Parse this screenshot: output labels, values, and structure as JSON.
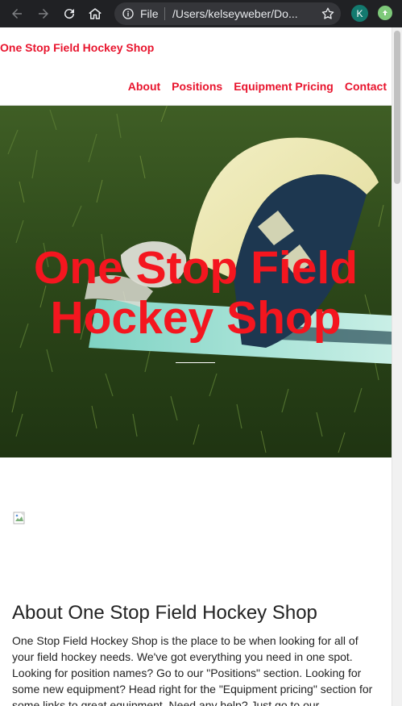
{
  "browser": {
    "scheme_label": "File",
    "url": "/Users/kelseyweber/Do...",
    "profile_initial": "K"
  },
  "site": {
    "brand": "One Stop Field Hockey Shop",
    "nav": [
      {
        "label": "About"
      },
      {
        "label": "Positions"
      },
      {
        "label": "Equipment Pricing"
      },
      {
        "label": "Contact"
      }
    ]
  },
  "hero": {
    "title": "One Stop Field Hockey Shop"
  },
  "about": {
    "heading": "About One Stop Field Hockey Shop",
    "body": "One Stop Field Hockey Shop is the place to be when looking for all of your field hockey needs. We've got everything you need in one spot. Looking for position names? Go to our \"Positions\" section. Looking for some new equipment? Head right for the \"Equipment pricing\" section for some links to great equipment. Need any help? Just go to our"
  },
  "colors": {
    "accent": "#e8142d",
    "hero_title": "#f4161f",
    "chrome_bg": "#202124"
  }
}
